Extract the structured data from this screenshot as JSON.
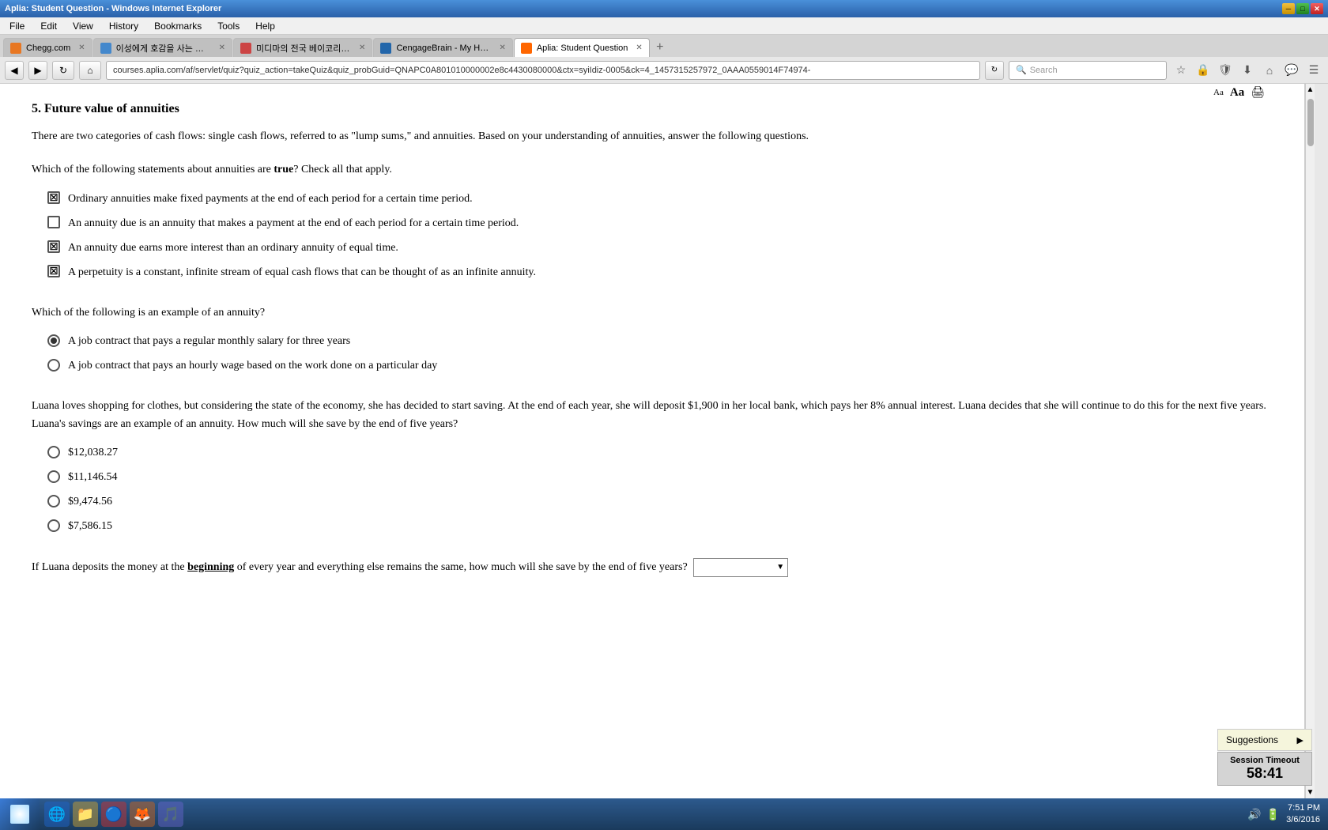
{
  "browser": {
    "title": "Aplia: Student Question - Windows Internet Explorer",
    "url": "courses.aplia.com/af/servlet/quiz?quiz_action=takeQuiz&quiz_probGuid=QNAPC0A801010000002e8c4430080000&ctx=syiIdiz-0005&ck=4_1457315257972_0AAA0559014F74974-",
    "tabs": [
      {
        "id": "chegg",
        "label": "Chegg.com",
        "active": false,
        "favicon_color": "#e87722"
      },
      {
        "id": "korean1",
        "label": "이성에게 호감을 사는 방법...",
        "active": false,
        "favicon_color": "#4488cc"
      },
      {
        "id": "korean2",
        "label": "미디마의 전국 베이코리언...",
        "active": false,
        "favicon_color": "#cc4444"
      },
      {
        "id": "cengage",
        "label": "CengageBrain - My Home",
        "active": false,
        "favicon_color": "#2266aa"
      },
      {
        "id": "aplia",
        "label": "Aplia: Student Question",
        "active": true,
        "favicon_color": "#ff6600"
      }
    ],
    "search_placeholder": "Search"
  },
  "menu": {
    "items": [
      "File",
      "Edit",
      "View",
      "History",
      "Bookmarks",
      "Tools",
      "Help"
    ]
  },
  "page": {
    "section_number": "5.",
    "section_title": "Future value of annuities",
    "intro_text": "There are two categories of cash flows: single cash flows, referred to as \"lump sums,\" and annuities. Based on your understanding of annuities, answer the following questions.",
    "question1": {
      "text": "Which of the following statements about annuities are ",
      "bold_word": "true",
      "text_after": "? Check all that apply.",
      "options": [
        {
          "id": "q1a",
          "checked": true,
          "label": "Ordinary annuities make fixed payments at the end of each period for a certain time period."
        },
        {
          "id": "q1b",
          "checked": false,
          "label": "An annuity due is an annuity that makes a payment at the end of each period for a certain time period."
        },
        {
          "id": "q1c",
          "checked": true,
          "label": "An annuity due earns more interest than an ordinary annuity of equal time."
        },
        {
          "id": "q1d",
          "checked": true,
          "label": "A perpetuity is a constant, infinite stream of equal cash flows that can be thought of as an infinite annuity."
        }
      ]
    },
    "question2": {
      "text": "Which of the following is an example of an annuity?",
      "options": [
        {
          "id": "q2a",
          "selected": true,
          "label": "A job contract that pays a regular monthly salary for three years"
        },
        {
          "id": "q2b",
          "selected": false,
          "label": "A job contract that pays an hourly wage based on the work done on a particular day"
        }
      ]
    },
    "question3": {
      "paragraph": "Luana loves shopping for clothes, but considering the state of the economy, she has decided to start saving. At the end of each year, she will deposit $1,900 in her local bank, which pays her 8% annual interest. Luana decides that she will continue to do this for the next five years. Luana's savings are an example of an annuity. How much will she save by the end of five years?",
      "options": [
        {
          "id": "q3a",
          "selected": false,
          "label": "$12,038.27"
        },
        {
          "id": "q3b",
          "selected": false,
          "label": "$11,146.54"
        },
        {
          "id": "q3c",
          "selected": false,
          "label": "$9,474.56"
        },
        {
          "id": "q3d",
          "selected": false,
          "label": "$7,586.15"
        }
      ]
    },
    "question4": {
      "text_before": "If Luana deposits the money at the ",
      "bold_word": "beginning",
      "text_after": " of every year and everything else remains the same, how much will she save by the end of five years?"
    }
  },
  "suggestions": {
    "label": "Suggestions",
    "close": "▶"
  },
  "session": {
    "label": "Session Timeout",
    "time": "58:41"
  },
  "taskbar": {
    "time": "7:51 PM",
    "date": "3/6/2016"
  }
}
